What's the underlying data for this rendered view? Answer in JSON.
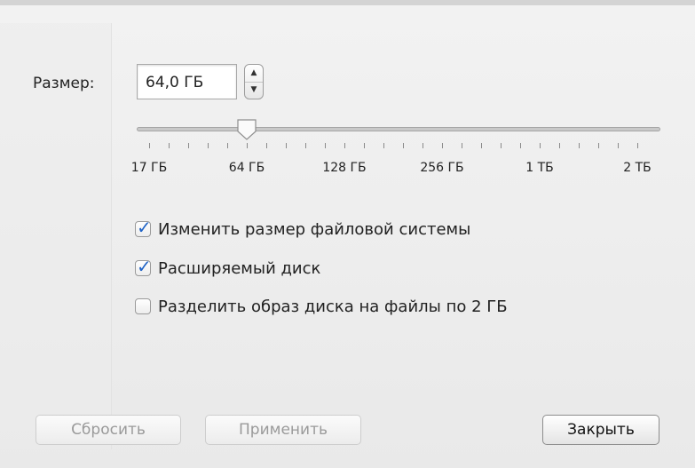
{
  "size": {
    "label": "Размер:",
    "value": "64,0 ГБ",
    "stepper_up": "▲",
    "stepper_down": "▼"
  },
  "slider": {
    "value_gb": 64,
    "tick_labels": [
      "17 ГБ",
      "64 ГБ",
      "128 ГБ",
      "256 ГБ",
      "1 ТБ",
      "2 ТБ"
    ]
  },
  "options": [
    {
      "label": "Изменить размер файловой системы",
      "checked": true
    },
    {
      "label": "Расширяемый диск",
      "checked": true
    },
    {
      "label": "Разделить образ диска на файлы по 2 ГБ",
      "checked": false
    }
  ],
  "buttons": {
    "reset": "Сбросить",
    "apply": "Применить",
    "close": "Закрыть"
  },
  "colors": {
    "accent": "#1f63c6"
  }
}
